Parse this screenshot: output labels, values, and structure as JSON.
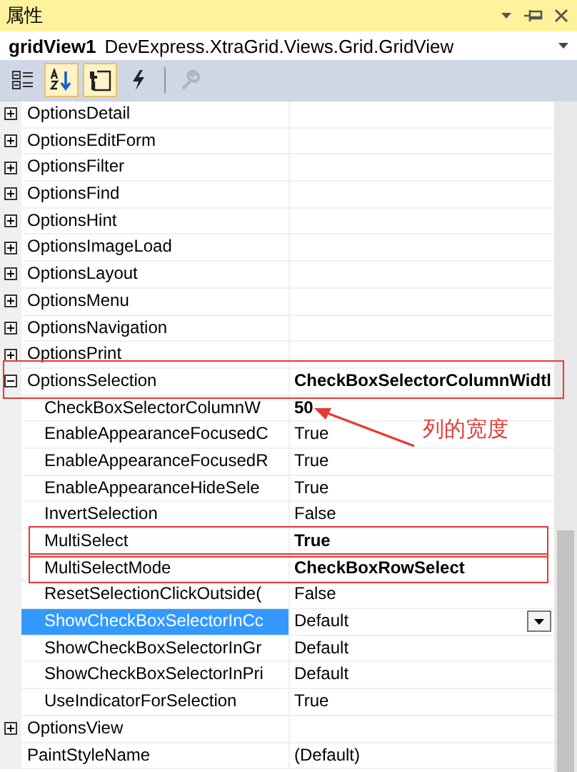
{
  "title_bar": {
    "title": "属性"
  },
  "object_selector": {
    "name": "gridView1",
    "type": "DevExpress.XtraGrid.Views.Grid.GridView"
  },
  "toolbar": [
    {
      "kind": "categorized",
      "selected": false,
      "disabled": false
    },
    {
      "kind": "alphabetical",
      "selected": true,
      "disabled": false
    },
    {
      "kind": "properties",
      "selected": true,
      "disabled": false
    },
    {
      "kind": "events",
      "selected": false,
      "disabled": false
    },
    {
      "kind": "property-pages",
      "selected": false,
      "disabled": true
    }
  ],
  "properties": [
    {
      "kind": "group",
      "name": "OptionsDetail",
      "expanded": false
    },
    {
      "kind": "group",
      "name": "OptionsEditForm",
      "expanded": false
    },
    {
      "kind": "group",
      "name": "OptionsFilter",
      "expanded": false
    },
    {
      "kind": "group",
      "name": "OptionsFind",
      "expanded": false
    },
    {
      "kind": "group",
      "name": "OptionsHint",
      "expanded": false
    },
    {
      "kind": "group",
      "name": "OptionsImageLoad",
      "expanded": false
    },
    {
      "kind": "group",
      "name": "OptionsLayout",
      "expanded": false
    },
    {
      "kind": "group",
      "name": "OptionsMenu",
      "expanded": false
    },
    {
      "kind": "group",
      "name": "OptionsNavigation",
      "expanded": false
    },
    {
      "kind": "group",
      "name": "OptionsPrint",
      "expanded": false
    },
    {
      "kind": "group",
      "name": "OptionsSelection",
      "value": "CheckBoxSelectorColumnWidtl",
      "bold": true,
      "expanded": true,
      "annotated": true,
      "children": [
        {
          "kind": "property",
          "name": "CheckBoxSelectorColumnW",
          "value": "50",
          "bold": true,
          "selected": false,
          "note": "列的宽度"
        },
        {
          "kind": "property",
          "name": "EnableAppearanceFocusedC",
          "value": "True",
          "bold": false,
          "selected": false
        },
        {
          "kind": "property",
          "name": "EnableAppearanceFocusedR",
          "value": "True",
          "bold": false,
          "selected": false
        },
        {
          "kind": "property",
          "name": "EnableAppearanceHideSele",
          "value": "True",
          "bold": false,
          "selected": false
        },
        {
          "kind": "property",
          "name": "InvertSelection",
          "value": "False",
          "bold": false,
          "selected": false
        },
        {
          "kind": "property",
          "name": "MultiSelect",
          "value": "True",
          "bold": true,
          "selected": false,
          "annotated": true
        },
        {
          "kind": "property",
          "name": "MultiSelectMode",
          "value": "CheckBoxRowSelect",
          "bold": true,
          "selected": false,
          "annotated": true
        },
        {
          "kind": "property",
          "name": "ResetSelectionClickOutside(",
          "value": "False",
          "bold": false,
          "selected": false
        },
        {
          "kind": "property",
          "name": "ShowCheckBoxSelectorInCc",
          "value": "Default",
          "bold": false,
          "selected": true
        },
        {
          "kind": "property",
          "name": "ShowCheckBoxSelectorInGr",
          "value": "Default",
          "bold": false,
          "selected": false
        },
        {
          "kind": "property",
          "name": "ShowCheckBoxSelectorInPri",
          "value": "Default",
          "bold": false,
          "selected": false
        },
        {
          "kind": "property",
          "name": "UseIndicatorForSelection",
          "value": "True",
          "bold": false,
          "selected": false
        }
      ]
    },
    {
      "kind": "group",
      "name": "OptionsView",
      "expanded": false
    },
    {
      "kind": "property",
      "name": "PaintStyleName",
      "value": "(Default)",
      "bold": false,
      "selected": false
    }
  ]
}
